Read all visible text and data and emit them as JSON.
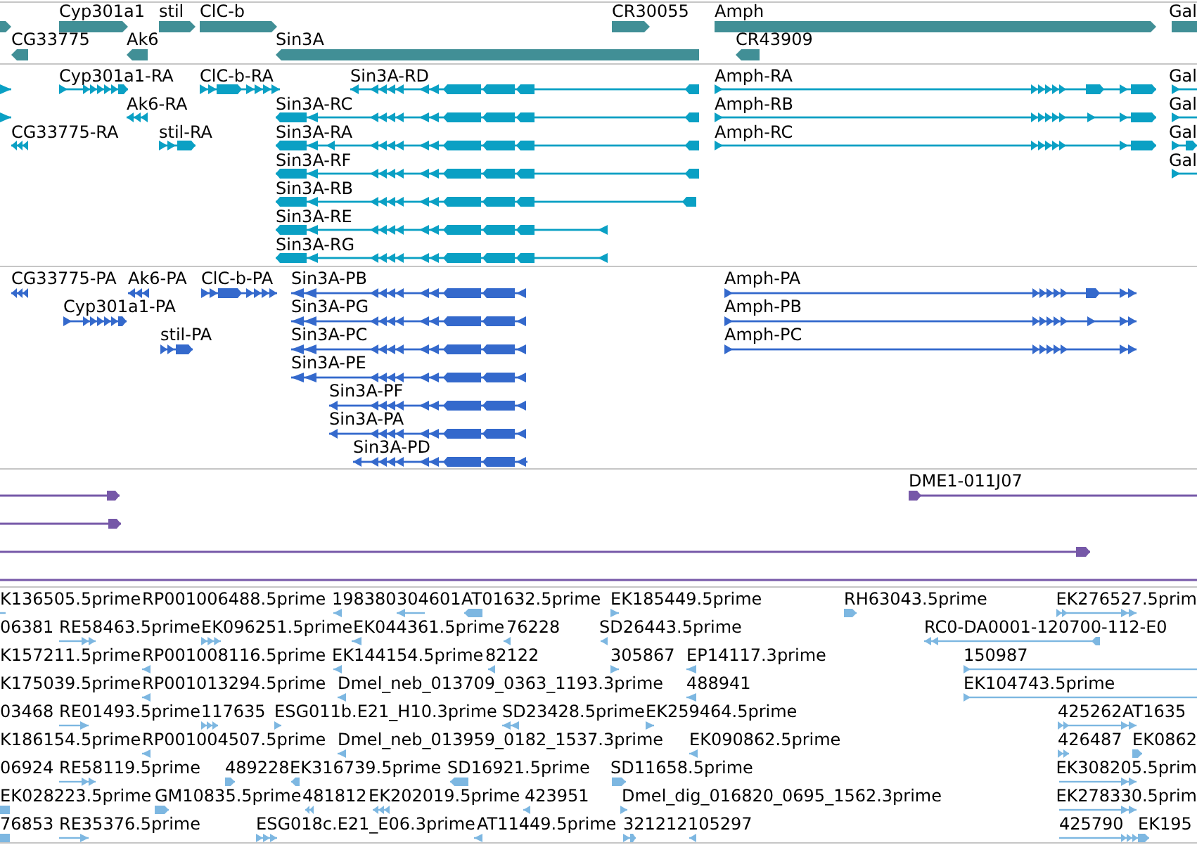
{
  "tracks": [
    {
      "kind": "gene",
      "color": "#418f96",
      "rows": [
        {
          "features": [
            {
              "reverse": false
            },
            {
              "label": "Cyp301a1",
              "reverse": false
            },
            {
              "label": "stil",
              "reverse": false
            },
            {
              "label": "ClC-b",
              "reverse": false
            },
            {
              "label": "CR30055",
              "reverse": false
            },
            {
              "label": "Amph",
              "reverse": false
            },
            {
              "label": "Gal"
            }
          ]
        },
        {
          "features": [
            {
              "label": "CG33775",
              "reverse": true
            },
            {
              "label": "Ak6",
              "reverse": true
            },
            {
              "label": "Sin3A",
              "reverse": true
            },
            {
              "label": "CR43909",
              "reverse": true
            }
          ]
        }
      ]
    },
    {
      "kind": "transcript",
      "color": "#0aa0c4",
      "rows": [
        {
          "features": [
            {
              "reverse": false
            },
            {
              "label": "Cyp301a1-RA",
              "reverse": false
            },
            {
              "label": "ClC-b-RA",
              "reverse": false
            },
            {
              "label": "Sin3A-RD",
              "reverse": true
            },
            {
              "label": "Amph-RA",
              "reverse": false
            },
            {
              "label": "Gal",
              "reverse": false
            }
          ]
        },
        {
          "features": [
            {
              "reverse": false
            },
            {
              "label": "Ak6-RA",
              "reverse": true
            },
            {
              "label": "Sin3A-RC",
              "reverse": true
            },
            {
              "label": "Amph-RB",
              "reverse": false
            },
            {
              "label": "Gal",
              "reverse": false
            }
          ]
        },
        {
          "features": [
            {
              "label": "CG33775-RA",
              "reverse": true
            },
            {
              "label": "stil-RA",
              "reverse": false
            },
            {
              "label": "Sin3A-RA",
              "reverse": true
            },
            {
              "label": "Amph-RC",
              "reverse": false
            },
            {
              "label": "Gal",
              "reverse": false
            }
          ]
        },
        {
          "features": [
            {
              "label": "Sin3A-RF",
              "reverse": true
            },
            {
              "label": "Gal",
              "reverse": false
            }
          ]
        },
        {
          "features": [
            {
              "label": "Sin3A-RB",
              "reverse": true
            }
          ]
        },
        {
          "features": [
            {
              "label": "Sin3A-RE",
              "reverse": true
            }
          ]
        },
        {
          "features": [
            {
              "label": "Sin3A-RG",
              "reverse": true
            }
          ]
        }
      ]
    },
    {
      "kind": "protein",
      "color": "#3469cc",
      "rows": [
        {
          "features": [
            {
              "label": "CG33775-PA",
              "reverse": true
            },
            {
              "label": "Ak6-PA",
              "reverse": true
            },
            {
              "label": "ClC-b-PA",
              "reverse": false
            },
            {
              "label": "Sin3A-PB",
              "reverse": true
            },
            {
              "label": "Amph-PA",
              "reverse": false
            }
          ]
        },
        {
          "features": [
            {
              "label": "Cyp301a1-PA",
              "reverse": false
            },
            {
              "label": "Sin3A-PG",
              "reverse": true
            },
            {
              "label": "Amph-PB",
              "reverse": false
            }
          ]
        },
        {
          "features": [
            {
              "label": "stil-PA",
              "reverse": false
            },
            {
              "label": "Sin3A-PC",
              "reverse": true
            },
            {
              "label": "Amph-PC",
              "reverse": false
            }
          ]
        },
        {
          "features": [
            {
              "label": "Sin3A-PE",
              "reverse": true
            }
          ]
        },
        {
          "features": [
            {
              "label": "Sin3A-PF",
              "reverse": true
            }
          ]
        },
        {
          "features": [
            {
              "label": "Sin3A-PA",
              "reverse": true
            }
          ]
        },
        {
          "features": [
            {
              "label": "Sin3A-PD",
              "reverse": true
            }
          ]
        }
      ]
    },
    {
      "kind": "clone",
      "color": "#7658a8",
      "rows": [
        {
          "features": [
            {
              "kind": "arrow",
              "reverse": false
            },
            {
              "kind": "arrow",
              "label": "DME1-011J07",
              "reverse": false
            }
          ]
        },
        {
          "features": [
            {
              "kind": "arrow",
              "reverse": false
            }
          ]
        },
        {
          "features": [
            {
              "kind": "arrow",
              "reverse": false
            }
          ]
        },
        {
          "features": [
            {
              "kind": "line"
            }
          ]
        }
      ]
    },
    {
      "kind": "est",
      "color": "#7db7e1",
      "rows": [
        {
          "features": [
            {
              "label": "K136505.5prime"
            },
            {
              "label": "RP001006488.5prime"
            },
            {
              "label": "198380",
              "reverse": true
            },
            {
              "label": "304601",
              "reverse": true
            },
            {
              "label": "AT01632.5prime",
              "reverse": true
            },
            {
              "label": "EK185449.5prime",
              "reverse": false
            },
            {
              "label": "RH63043.5prime",
              "reverse": false
            },
            {
              "label": "EK276527.5prim",
              "reverse": false
            }
          ]
        },
        {
          "features": [
            {
              "label": "06381"
            },
            {
              "label": "RE58463.5prime",
              "reverse": false
            },
            {
              "label": "EK096251.5prime",
              "reverse": false
            },
            {
              "label": "EK044361.5prime",
              "reverse": true
            },
            {
              "label": "76228",
              "reverse": true
            },
            {
              "label": "SD26443.5prime",
              "reverse": true
            },
            {
              "label": "RC0-DA0001-120700-112-E0",
              "reverse": true
            }
          ]
        },
        {
          "features": [
            {
              "label": "K157211.5prime"
            },
            {
              "label": "RP001008116.5prime",
              "reverse": true
            },
            {
              "label": "EK144154.5prime",
              "reverse": true
            },
            {
              "label": "82122",
              "reverse": true
            },
            {
              "label": "305867",
              "reverse": false
            },
            {
              "label": "EP14117.3prime",
              "reverse": true
            },
            {
              "label": "150987",
              "reverse": false
            }
          ]
        },
        {
          "features": [
            {
              "label": "K175039.5prime"
            },
            {
              "label": "RP001013294.5prime",
              "reverse": true
            },
            {
              "label": "Dmel_neb_013709_0363_1193.3prime",
              "reverse": true
            },
            {
              "label": "488941",
              "reverse": true
            },
            {
              "label": "EK104743.5prime",
              "reverse": false
            }
          ]
        },
        {
          "features": [
            {
              "label": "03468"
            },
            {
              "label": "RE01493.5prime",
              "reverse": false
            },
            {
              "label": "117635",
              "reverse": false
            },
            {
              "label": "ESG011b.E21_H10.3prime",
              "reverse": false
            },
            {
              "label": "SD23428.5prime",
              "reverse": true
            },
            {
              "label": "EK259464.5prime",
              "reverse": false
            },
            {
              "label": "425262",
              "reverse": false
            },
            {
              "label": "AT1635"
            }
          ]
        },
        {
          "features": [
            {
              "label": "K186154.5prime"
            },
            {
              "label": "RP001004507.5prime",
              "reverse": true
            },
            {
              "label": "Dmel_neb_013959_0182_1537.3prime",
              "reverse": true
            },
            {
              "label": "EK090862.5prime",
              "reverse": true
            },
            {
              "label": "426487",
              "reverse": false
            },
            {
              "label": "EK0862",
              "reverse": false
            }
          ]
        },
        {
          "features": [
            {
              "label": "06924"
            },
            {
              "label": "RE58119.5prime",
              "reverse": false
            },
            {
              "label": "489228",
              "reverse": false
            },
            {
              "label": "EK316739.5prime",
              "reverse": true
            },
            {
              "label": "SD16921.5prime",
              "reverse": true
            },
            {
              "label": "SD11658.5prime",
              "reverse": false
            },
            {
              "label": "EK308205.5prim",
              "reverse": false
            }
          ]
        },
        {
          "features": [
            {
              "label": "EK028223.5prime"
            },
            {
              "label": "GM10835.5prime",
              "reverse": false
            },
            {
              "label": "481812",
              "reverse": true
            },
            {
              "label": "EK202019.5prime",
              "reverse": true
            },
            {
              "label": "423951",
              "reverse": true
            },
            {
              "label": "Dmel_dig_016820_0695_1562.3prime",
              "reverse": false
            },
            {
              "label": "EK278330.5prim",
              "reverse": false
            }
          ]
        },
        {
          "features": [
            {
              "label": "76853"
            },
            {
              "label": "RE35376.5prime",
              "reverse": false
            },
            {
              "label": "ESG018c.E21_E06.3prime",
              "reverse": false
            },
            {
              "label": "AT11449.5prime",
              "reverse": true
            },
            {
              "label": "321212",
              "reverse": false
            },
            {
              "label": "105297",
              "reverse": true
            },
            {
              "label": "425790",
              "reverse": false
            },
            {
              "label": "EK195"
            }
          ]
        }
      ]
    }
  ]
}
